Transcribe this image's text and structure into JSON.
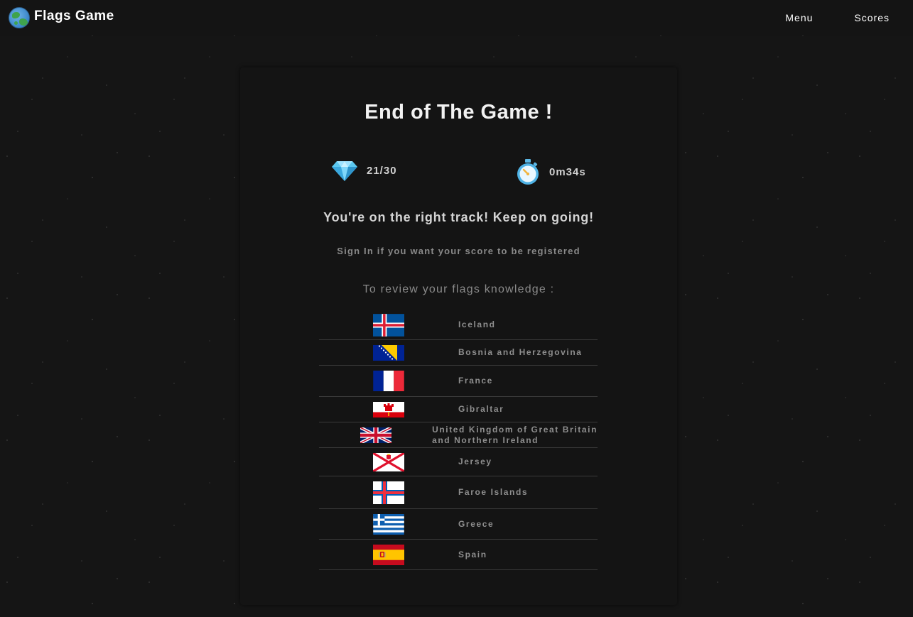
{
  "header": {
    "title": "Flags Game",
    "nav": [
      {
        "label": "Menu"
      },
      {
        "label": "Scores"
      }
    ]
  },
  "result": {
    "title": "End of The Game !",
    "score": "21/30",
    "time": "0m34s",
    "message": "You're on the right track! Keep on going!",
    "signin_note": "Sign In if you want your score to be registered",
    "review_heading": "To review your flags knowledge :"
  },
  "review_list": [
    {
      "country": "Iceland",
      "flag": "iceland-flag"
    },
    {
      "country": "Bosnia and Herzegovina",
      "flag": "bosnia-flag"
    },
    {
      "country": "France",
      "flag": "france-flag"
    },
    {
      "country": "Gibraltar",
      "flag": "gibraltar-flag"
    },
    {
      "country": "United Kingdom of Great Britain",
      "country_line2": "and Northern Ireland",
      "flag": "uk-flag"
    },
    {
      "country": "Jersey",
      "flag": "jersey-flag"
    },
    {
      "country": "Faroe Islands",
      "flag": "faroe-flag"
    },
    {
      "country": "Greece",
      "flag": "greece-flag"
    },
    {
      "country": "Spain",
      "flag": "spain-flag"
    }
  ],
  "icons": {
    "logo": "globe-icon",
    "score": "diamond-icon",
    "time": "stopwatch-icon"
  },
  "colors": {
    "background": "#151515",
    "card": "#141414",
    "text_primary": "#f2f2f2",
    "text_muted": "#8a8a8a"
  }
}
